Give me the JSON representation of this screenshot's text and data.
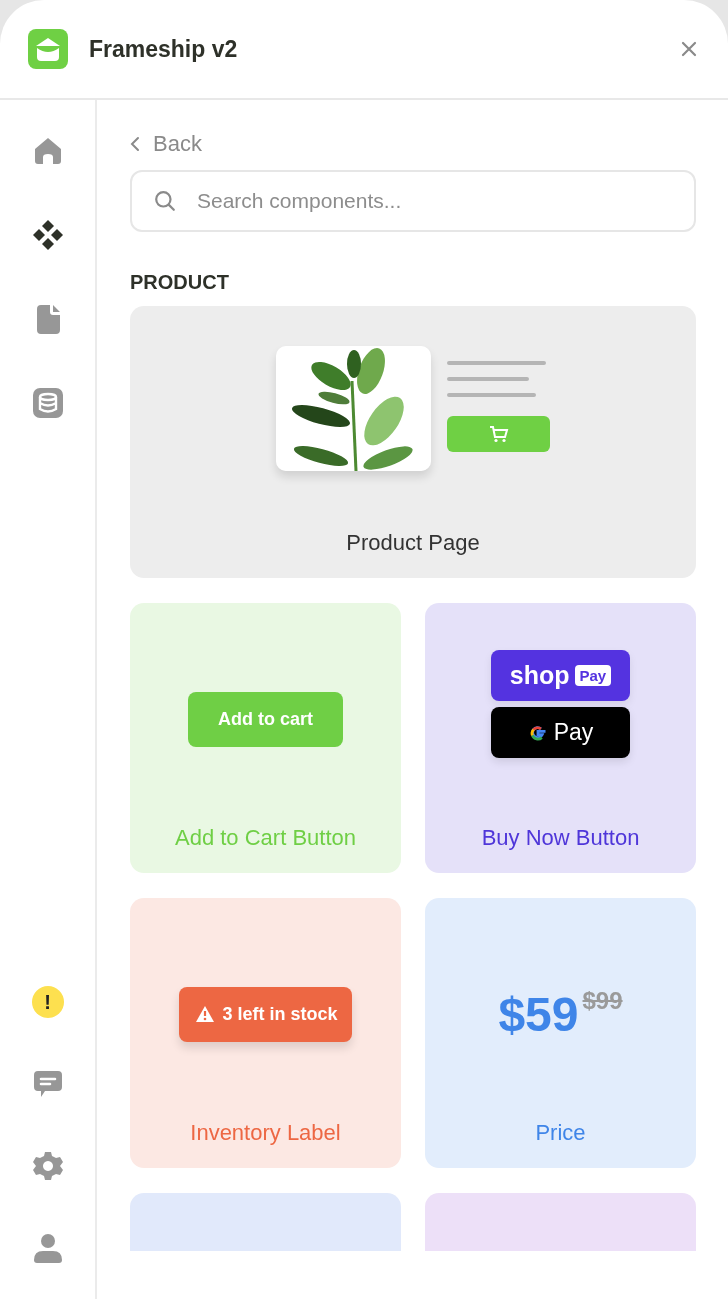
{
  "window": {
    "title": "Frameship v2"
  },
  "sidebar": {
    "top_items": [
      {
        "kind": "home",
        "selected": false
      },
      {
        "kind": "components",
        "selected": true
      },
      {
        "kind": "file",
        "selected": false
      },
      {
        "kind": "database",
        "selected": false
      }
    ],
    "bottom_items": [
      {
        "kind": "alert",
        "label": "!"
      },
      {
        "kind": "chat"
      },
      {
        "kind": "settings"
      },
      {
        "kind": "user"
      }
    ]
  },
  "back": {
    "label": "Back"
  },
  "search": {
    "placeholder": "Search components..."
  },
  "section": {
    "title": "PRODUCT"
  },
  "cards": [
    {
      "kind": "product_page",
      "title": "Product Page",
      "color": "#333333"
    },
    {
      "kind": "add_to_cart",
      "title": "Add to Cart Button",
      "color": "#6fcf45",
      "button": "Add to cart"
    },
    {
      "kind": "buy_now",
      "title": "Buy Now Button",
      "color": "#4f36d9",
      "shop_word": "shop",
      "shop_badge": "Pay",
      "gpay_word": "Pay"
    },
    {
      "kind": "inventory",
      "title": "Inventory Label",
      "color": "#ed6743",
      "label": "3 left in stock"
    },
    {
      "kind": "price",
      "title": "Price",
      "color": "#3f85e8",
      "price": "$59",
      "old_price": "$99"
    },
    {
      "kind": "blank",
      "color": "#e1e9fb"
    },
    {
      "kind": "blank",
      "color": "#ede0f8"
    }
  ]
}
